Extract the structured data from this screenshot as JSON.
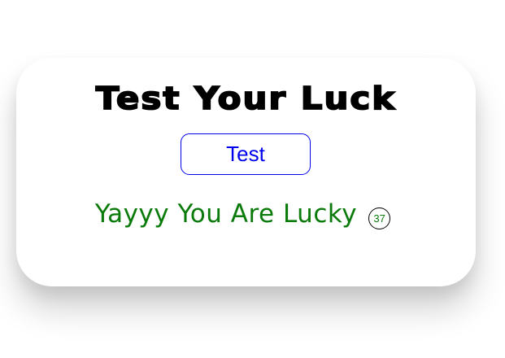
{
  "card": {
    "title": "Test Your Luck",
    "button_label": "Test",
    "result_text": "Yayyy You Are Lucky",
    "number_badge": "37"
  },
  "colors": {
    "title": "#000000",
    "button": "#0000ee",
    "result": "#0a7a0a",
    "badge_border": "#000000"
  }
}
